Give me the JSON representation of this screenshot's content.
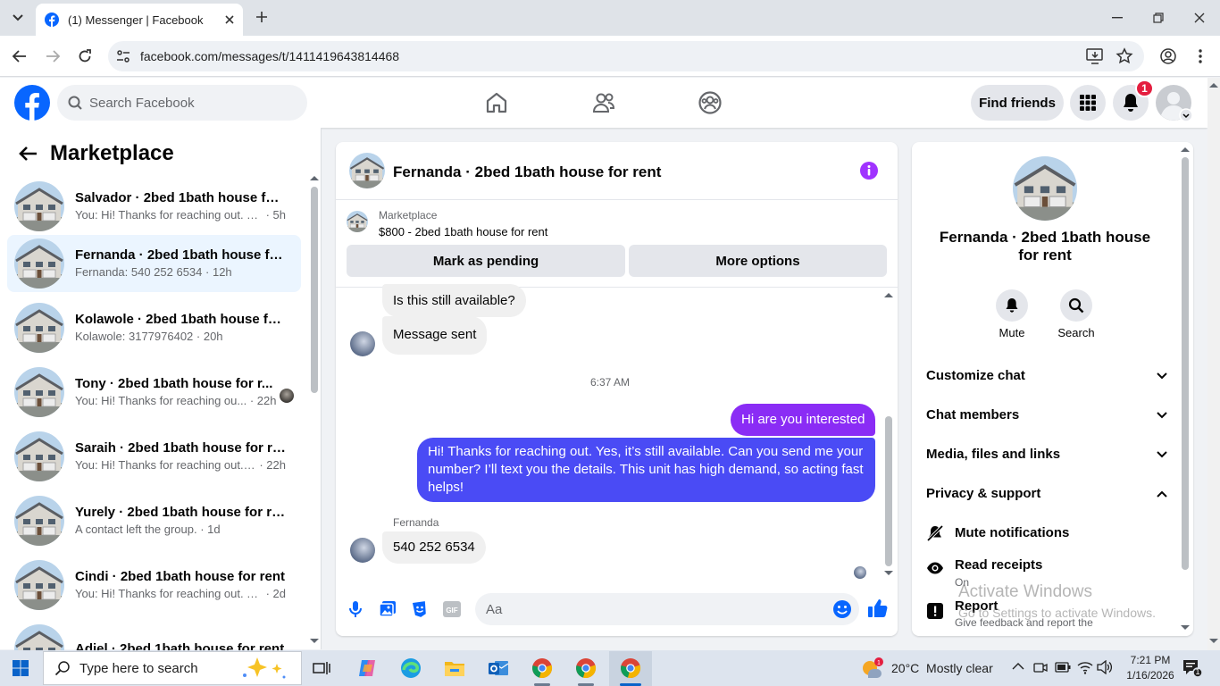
{
  "browser": {
    "tab_title": "(1) Messenger | Facebook",
    "url": "facebook.com/messages/t/1411419643814468"
  },
  "header": {
    "search_placeholder": "Search Facebook",
    "find_friends": "Find friends",
    "notification_count": "1"
  },
  "sidebar": {
    "title": "Marketplace",
    "conversations": [
      {
        "name": "Salvador · 2bed 1bath house for ...",
        "preview": "You: Hi! Thanks for reaching out. Ye...",
        "time": "5h"
      },
      {
        "name": "Fernanda · 2bed 1bath house for...",
        "preview": "Fernanda: 540 252 6534",
        "time": "12h"
      },
      {
        "name": "Kolawole · 2bed 1bath house for...",
        "preview": "Kolawole: 3177976402",
        "time": "20h"
      },
      {
        "name": "Tony · 2bed 1bath house for r...",
        "preview": "You: Hi! Thanks for reaching ou...",
        "time": "22h"
      },
      {
        "name": "Saraih · 2bed 1bath house for rent",
        "preview": "You: Hi! Thanks for reaching out. Y...",
        "time": "22h"
      },
      {
        "name": "Yurely · 2bed 1bath house for rent",
        "preview": "A contact left the group.",
        "time": "1d"
      },
      {
        "name": "Cindi · 2bed 1bath house for rent",
        "preview": "You: Hi! Thanks for reaching out. Ye...",
        "time": "2d"
      },
      {
        "name": "Adiel · 2bed 1bath house for rent",
        "preview": "",
        "time": ""
      }
    ]
  },
  "chat": {
    "title": "Fernanda · 2bed 1bath house for rent",
    "listing_source": "Marketplace",
    "listing": "$800 - 2bed 1bath house for rent",
    "mark_pending": "Mark as pending",
    "more_options": "More options",
    "messages": {
      "m1": "Is this still available?",
      "m2": "Message sent",
      "timestamp": "6:37 AM",
      "m3": "Hi are you interested",
      "m4": "Hi! Thanks for reaching out. Yes, it’s still available. Can you send me your number? I’ll text you the details. This unit has high demand, so acting fast helps!",
      "sender": "Fernanda",
      "m5": "540 252 6534"
    },
    "composer_placeholder": "Aa"
  },
  "info": {
    "name": "Fernanda · 2bed 1bath house for rent",
    "mute": "Mute",
    "search": "Search",
    "sections": [
      "Customize chat",
      "Chat members",
      "Media, files and links",
      "Privacy & support"
    ],
    "mute_notifications": "Mute notifications",
    "read_receipts": "Read receipts",
    "read_receipts_state": "On",
    "report": "Report",
    "report_desc": "Give feedback and report the"
  },
  "watermark": {
    "title": "Activate Windows",
    "subtitle": "Go to Settings to activate Windows."
  },
  "taskbar": {
    "search_placeholder": "Type here to search",
    "weather": "20°C  Mostly clear",
    "time": "7:21 PM",
    "date": "1/16/2026",
    "notif_count": "1"
  },
  "colors": {
    "facebook_blue": "#0866ff",
    "messenger_purple": "#a033ff",
    "outgoing_bubble": "#4a4bf5"
  }
}
